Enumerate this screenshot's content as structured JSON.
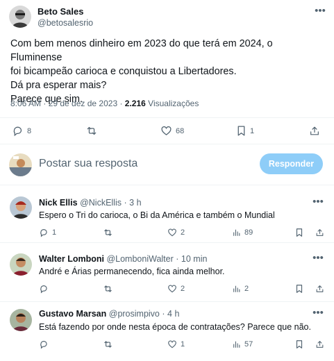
{
  "post": {
    "author_name": "Beto Sales",
    "author_handle": "@betosalesrio",
    "text_lines": [
      "Com bem menos dinheiro em 2023 do que terá em 2024, o Fluminense",
      "foi bicampeão carioca e conquistou a Libertadores.",
      "Dá pra esperar mais?",
      "Parece que sim."
    ],
    "timestamp": "8:06 AM · 29 de dez de 2023",
    "views_separator": " · ",
    "views_count": "2.216",
    "views_label": " Visualizações",
    "replies": "8",
    "reposts": "",
    "likes": "68",
    "bookmarks": "1"
  },
  "composer": {
    "placeholder": "Postar sua resposta",
    "button_label": "Responder"
  },
  "replies": [
    {
      "name": "Nick Ellis",
      "handle": "@NickEllis",
      "time": "3 h",
      "text": "Espero o Tri do carioca, o Bi da América e também o Mundial",
      "replies": "1",
      "reposts": "",
      "likes": "2",
      "views": "89"
    },
    {
      "name": "Walter Lomboni",
      "handle": "@LomboniWalter",
      "time": "10 min",
      "text": "André e Árias permanecendo, fica ainda melhor.",
      "replies": "",
      "reposts": "",
      "likes": "2",
      "views": "2"
    },
    {
      "name": "Gustavo Marsan",
      "handle": "@prosimpivo",
      "time": "4 h",
      "text": "Está fazendo por onde nesta época de contratações? Parece que não.",
      "replies": "",
      "reposts": "",
      "likes": "1",
      "views": "57"
    }
  ],
  "separator_dot": "·",
  "colors": {
    "text": "#0f1419",
    "secondary": "#536471",
    "divider": "#eff3f4",
    "button_disabled": "#8ecdf8"
  }
}
